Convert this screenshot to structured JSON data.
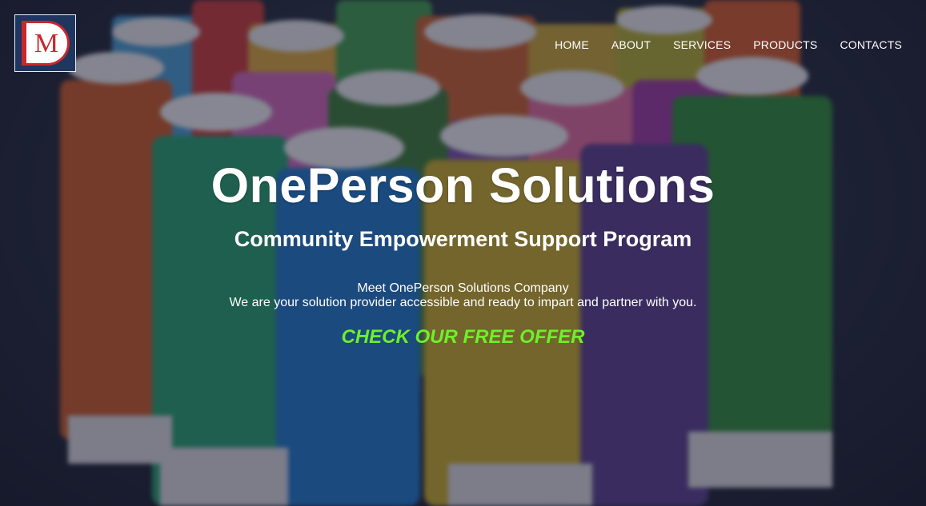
{
  "logo": {
    "letter": "M",
    "colors": {
      "frame": "#1f3760",
      "mark": "#c8282d",
      "background": "#ffffff"
    }
  },
  "nav": {
    "items": [
      {
        "label": "HOME"
      },
      {
        "label": "ABOUT"
      },
      {
        "label": "SERVICES"
      },
      {
        "label": "PRODUCTS"
      },
      {
        "label": "CONTACTS"
      }
    ]
  },
  "hero": {
    "title": "OnePerson Solutions",
    "subtitle": "Community Empowerment Support Program",
    "description_line1": "Meet OnePerson Solutions Company",
    "description_line2": "We are your solution provider accessible and ready to impart and partner with you.",
    "cta_label": "CHECK OUR FREE OFFER",
    "background": "colorful thread spools"
  },
  "colors": {
    "text": "#ffffff",
    "cta": "#6ef02a",
    "overlay": "#161a2c"
  }
}
